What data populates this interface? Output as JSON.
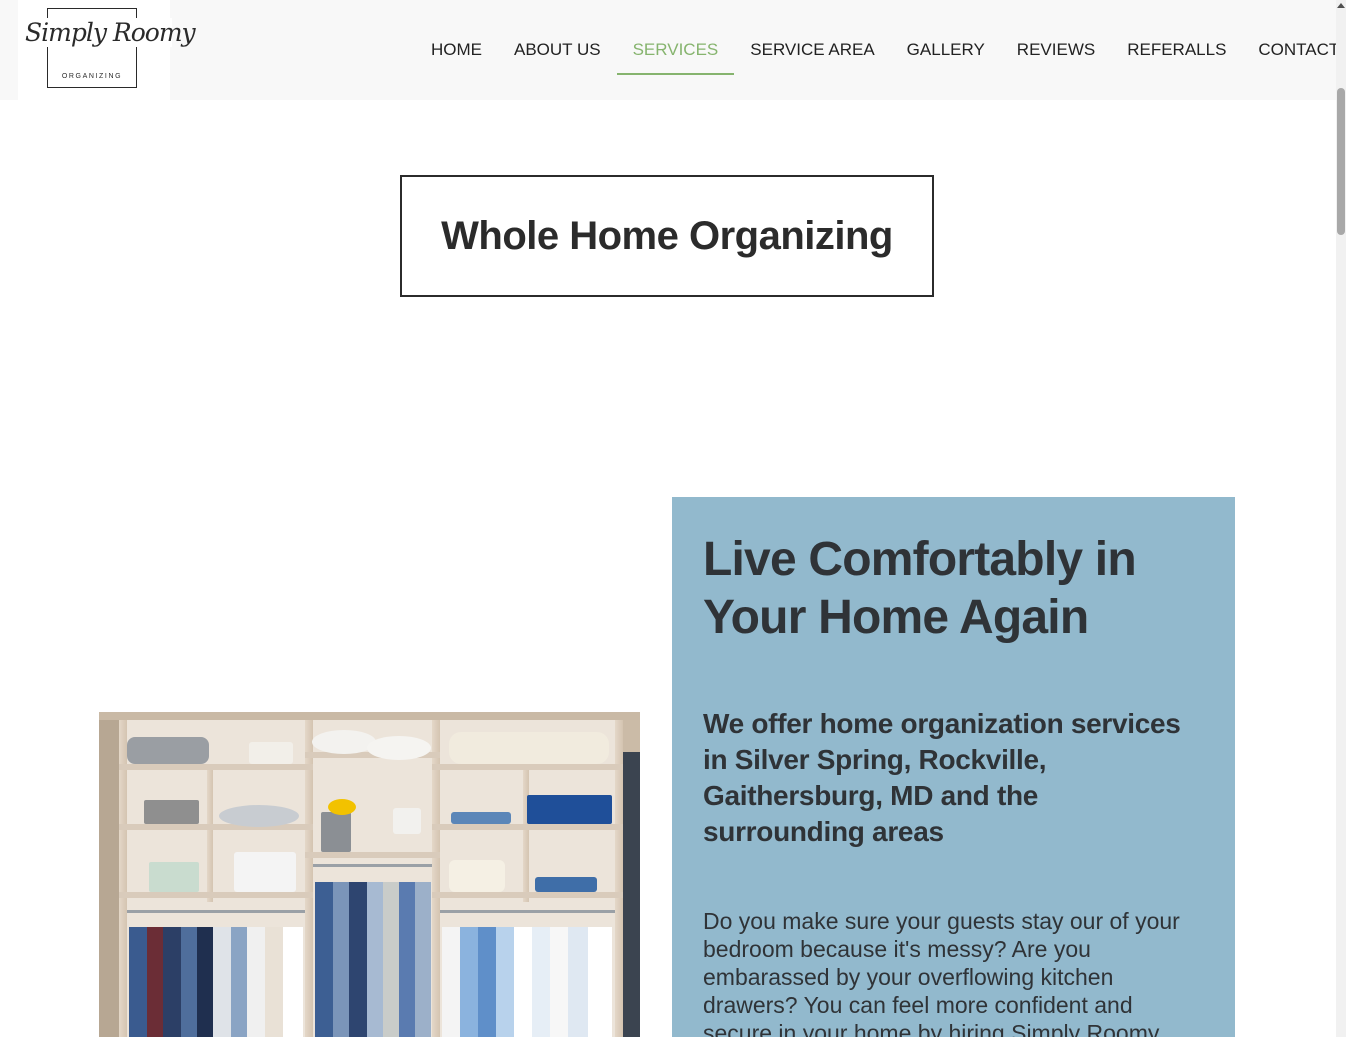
{
  "logo": {
    "script": "Simply Roomy",
    "subtitle": "ORGANIZING"
  },
  "nav": {
    "items": [
      {
        "label": "HOME"
      },
      {
        "label": "ABOUT US"
      },
      {
        "label": "SERVICES",
        "active": true
      },
      {
        "label": "SERVICE AREA"
      },
      {
        "label": "GALLERY"
      },
      {
        "label": "REVIEWS"
      },
      {
        "label": "REFERALLS"
      },
      {
        "label": "CONTACT"
      }
    ]
  },
  "page": {
    "title": "Whole Home Organizing"
  },
  "panel": {
    "heading": "Live Comfortably in Your Home Again",
    "subheading": "We offer home organization services in Silver Spring, Rockville, Gaithersburg, MD and the surrounding areas",
    "body": "Do you make sure your guests stay our of your bedroom because it's messy? Are you embarassed by your overflowing kitchen drawers? You can feel more confident and secure in your home by hiring Simply Roomy Organizing. We have years"
  },
  "colors": {
    "accent": "#86b46e",
    "panel_bg": "#92b9cd",
    "header_bg": "#f8f8f8",
    "text": "#2b2b2b"
  }
}
